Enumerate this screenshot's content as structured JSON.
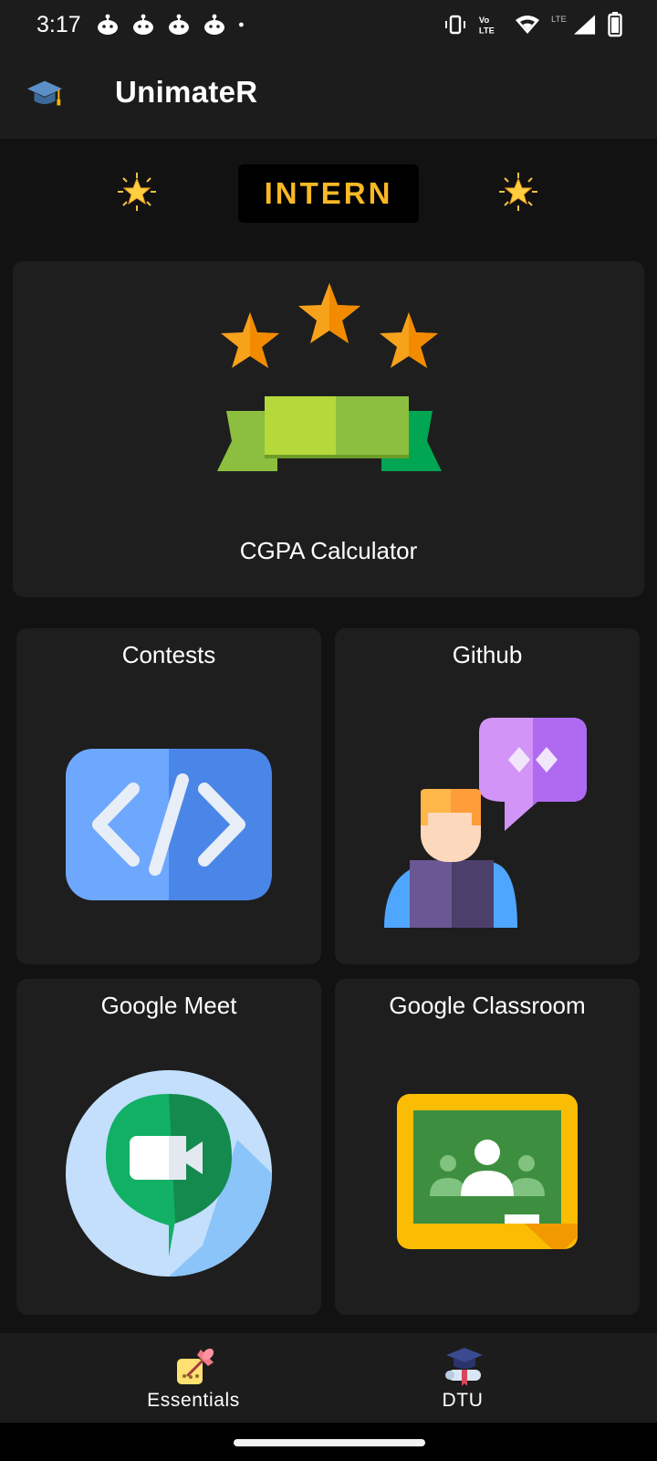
{
  "status_bar": {
    "time": "3:17",
    "notification_icons": [
      "reddit-icon",
      "reddit-icon",
      "reddit-icon",
      "reddit-icon",
      "more-dot-icon"
    ],
    "system_icons": [
      "vibrate-icon",
      "volte-icon",
      "wifi-icon",
      "lte-signal-icon",
      "battery-icon"
    ]
  },
  "app_bar": {
    "logo_icon": "graduation-cap-icon",
    "title": "UnimateR"
  },
  "role_banner": {
    "label": "INTERN",
    "left_icon": "sparkle-star-icon",
    "right_icon": "sparkle-star-icon",
    "label_color": "#f9b825"
  },
  "cards": {
    "cgpa": {
      "label": "CGPA Calculator",
      "icon": "three-stars-ribbon-icon"
    },
    "contests": {
      "label": "Contests",
      "icon": "code-brackets-icon"
    },
    "github": {
      "label": "Github",
      "icon": "developer-code-bubble-icon"
    },
    "meet": {
      "label": "Google Meet",
      "icon": "google-meet-icon"
    },
    "classroom": {
      "label": "Google Classroom",
      "icon": "google-classroom-icon"
    }
  },
  "bottom_nav": {
    "items": [
      {
        "label": "Essentials",
        "icon": "pushpin-note-icon"
      },
      {
        "label": "DTU",
        "icon": "graduate-diploma-icon"
      }
    ]
  },
  "colors": {
    "background": "#121212",
    "surface": "#1e1e1e",
    "bar": "#1c1c1c",
    "accent": "#f9b825"
  }
}
